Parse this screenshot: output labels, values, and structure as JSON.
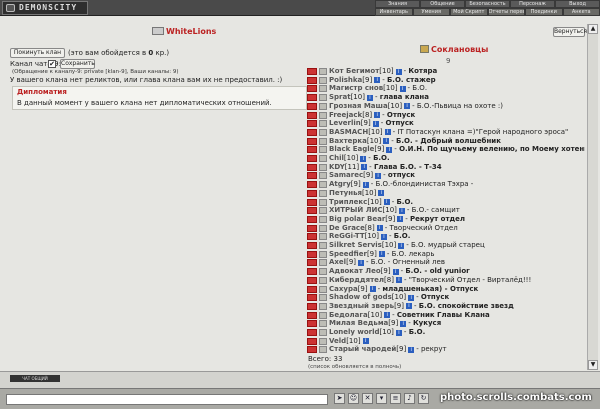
{
  "topbar": {
    "logo": "DEMONSCITY",
    "menu_row1": [
      "Знания",
      "Общение",
      "Безопасность",
      "Персонаж",
      "Выход"
    ],
    "menu_row2": [
      "Инвентарь",
      "Умения",
      "Мой Скрипт",
      "Отчеты переводов",
      "Поединки",
      "Анкета"
    ]
  },
  "clan": {
    "name": "WhiteLions",
    "back_label": "Вернуться",
    "leave_label": "Покинуть клан",
    "leave_note_prefix": "(это вам обойдется в ",
    "leave_cost": "0",
    "leave_note_suffix": " кр.)",
    "chat_label": "Канал чата-9:",
    "chat_checked": "✔",
    "save_label": "Сохранить",
    "chat_hint": "(Обращение к каналу-9: private [klan-9], Ваши каналы: 9)",
    "relic_note": "У вашего клана нет реликтов, или глава клана вам их не предоставил. :)",
    "diplomacy_title": "Дипломатия",
    "diplomacy_text": "В данный момент у вашего клана нет дипломатических отношений."
  },
  "allies": {
    "title": "Соклановцы",
    "rank": "9"
  },
  "members": [
    {
      "nick": "Кот Бегимот",
      "level": "[10]",
      "dash": "-",
      "status": "Котяра",
      "bold": true
    },
    {
      "nick": "Polishka",
      "level": "[9]",
      "dash": "-",
      "status": "Б.О. стажер",
      "bold": true
    },
    {
      "nick": "Магистр снов",
      "level": "[10]",
      "dash": "-",
      "status": "Б.О.",
      "bold": false
    },
    {
      "nick": "Sprat",
      "level": "[10]",
      "dash": "-",
      "status": "глава клана",
      "bold": true
    },
    {
      "nick": "Грозная Маша",
      "level": "[10]",
      "dash": "-",
      "status": "Б.О.-Пьвица на охоте :)",
      "bold": false
    },
    {
      "nick": "Freejack",
      "level": "[8]",
      "dash": "-",
      "status": "Отпуск",
      "bold": true
    },
    {
      "nick": "Leverlin",
      "level": "[9]",
      "dash": "-",
      "status": "Отпуск",
      "bold": true
    },
    {
      "nick": "BASMACH",
      "level": "[10]",
      "dash": "-",
      "status": "IT Потаскун клана =)\"Герой народного эроса\"",
      "bold": false
    },
    {
      "nick": "Вахтерка",
      "level": "[10]",
      "dash": "-",
      "status": "Б.О. - Добрый волшебник",
      "bold": true
    },
    {
      "nick": "Black Eagle",
      "level": "[9]",
      "dash": "-",
      "status": "О.И.Н. По щучьему велению, по Моему хотенью",
      "bold": true
    },
    {
      "nick": "Chil",
      "level": "[10]",
      "dash": "-",
      "status": "Б.О.",
      "bold": true
    },
    {
      "nick": "KDY",
      "level": "[11]",
      "dash": "-",
      "status": "Глава Б.О. - Т-34",
      "bold": true
    },
    {
      "nick": "Samarec",
      "level": "[9]",
      "dash": "-",
      "status": "отпуск",
      "bold": true
    },
    {
      "nick": "Atgry",
      "level": "[9]",
      "dash": "-",
      "status": "Б.О.-блондинистая Тэхра -",
      "bold": false
    },
    {
      "nick": "Петунья",
      "level": "[10]",
      "dash": "",
      "status": "",
      "bold": false
    },
    {
      "nick": "Триплекс",
      "level": "[10]",
      "dash": "-",
      "status": "Б.О.",
      "bold": true
    },
    {
      "nick": "ХИТРЫЙ ЛИС",
      "level": "[10]",
      "dash": "-",
      "status": "Б.О.- самщит",
      "bold": false
    },
    {
      "nick": "Big polar Bear",
      "level": "[9]",
      "dash": "-",
      "status": "Рекрут отдел",
      "bold": true
    },
    {
      "nick": "De Grace",
      "level": "[8]",
      "dash": "-",
      "status": "Творческий Отдел",
      "bold": false
    },
    {
      "nick": "ReGGi-TT",
      "level": "[10]",
      "dash": "-",
      "status": "Б.О.",
      "bold": true
    },
    {
      "nick": "Silkret Servis",
      "level": "[10]",
      "dash": "-",
      "status": "Б.О. мудрый старец",
      "bold": false
    },
    {
      "nick": "Speedfier",
      "level": "[9]",
      "dash": "-",
      "status": "Б.О. лекарь",
      "bold": false
    },
    {
      "nick": "Axel",
      "level": "[9]",
      "dash": "-",
      "status": "Б.О. - Огненный лев",
      "bold": false
    },
    {
      "nick": "Адвокат Лео",
      "level": "[9]",
      "dash": "-",
      "status": "Б.О. - old yunior",
      "bold": true
    },
    {
      "nick": "Киберддятел",
      "level": "[8]",
      "dash": "-",
      "status": "\"Творческий Отдел - Вирталёд!!!",
      "bold": false
    },
    {
      "nick": "Сахура",
      "level": "[9]",
      "dash": "-",
      "status": "младшенькая) - Отпуск",
      "bold": true
    },
    {
      "nick": "Shadow of gods",
      "level": "[10]",
      "dash": "-",
      "status": "Отпуск",
      "bold": true
    },
    {
      "nick": "Звездный зверь",
      "level": "[9]",
      "dash": "-",
      "status": "Б.О. спокойствие звезд",
      "bold": true
    },
    {
      "nick": "Бедолага",
      "level": "[10]",
      "dash": "-",
      "status": "Советник Главы Клана",
      "bold": true
    },
    {
      "nick": "Милая Ведьма",
      "level": "[9]",
      "dash": "-",
      "status": "Кукуся",
      "bold": true
    },
    {
      "nick": "Lonely world",
      "level": "[10]",
      "dash": "-",
      "status": "Б.О.",
      "bold": true
    },
    {
      "nick": "Veld",
      "level": "[10]",
      "dash": "",
      "status": "",
      "bold": false
    },
    {
      "nick": "Старый чародей",
      "level": "[9]",
      "dash": "-",
      "status": "рекрут",
      "bold": false
    }
  ],
  "total": {
    "label": "Всего: ",
    "count": "33",
    "note": "(список обновляется в полночь)"
  },
  "chat_strip_label": "ЧАТ  ОБЩИЙ",
  "watermark": "photo.scrolls.combats.com"
}
